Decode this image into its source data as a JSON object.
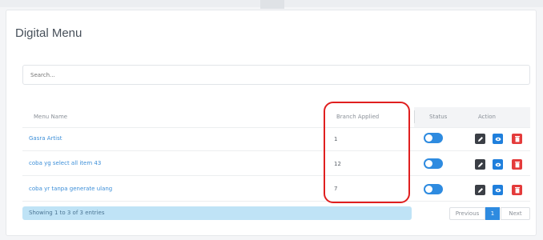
{
  "page": {
    "title": "Digital Menu"
  },
  "search": {
    "placeholder": "Search..."
  },
  "table": {
    "columns": {
      "menu_name": "Menu Name",
      "branch_applied": "Branch Applied",
      "status": "Status",
      "action": "Action"
    },
    "rows": [
      {
        "menu_name": "Gasra Artist",
        "branch_applied": "1",
        "status": "on"
      },
      {
        "menu_name": "coba yg select all item 43",
        "branch_applied": "12",
        "status": "on"
      },
      {
        "menu_name": "coba yr tanpa generate ulang",
        "branch_applied": "7",
        "status": "on"
      }
    ]
  },
  "footer": {
    "info": "Showing 1 to 3 of 3 entries",
    "previous": "Previous",
    "page": "1",
    "next": "Next"
  },
  "colors": {
    "accent": "#2e8be0",
    "link": "#3d8fd8",
    "delete": "#e43b3b",
    "edit": "#3b3f46",
    "highlight": "#e01f1f"
  },
  "icons": {
    "edit": "pencil-icon",
    "view": "eye-icon",
    "delete": "trash-icon"
  }
}
